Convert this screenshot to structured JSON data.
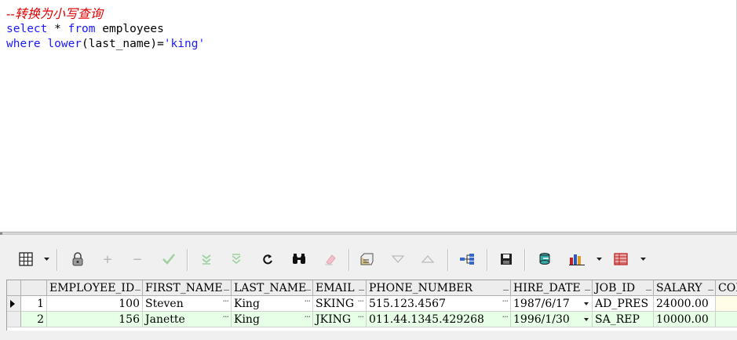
{
  "editor": {
    "comment": "--转换为小写查询",
    "line2": {
      "kw1": "select",
      "rest1": " * ",
      "kw2": "from",
      "rest2": " employees"
    },
    "line3": {
      "kw1": "where",
      "sp": " ",
      "kw2": "lower",
      "rest": "(last_name)=",
      "str": "'king'"
    }
  },
  "toolbar_icons": [
    "grid-icon",
    "lock-icon",
    "add-record-icon",
    "delete-record-icon",
    "post-changes-icon",
    "clear-filter-icon",
    "query-filter-icon",
    "refresh-icon",
    "find-icon",
    "clear-icon",
    "export-icon",
    "next-icon",
    "previous-icon",
    "tree-icon",
    "save-icon",
    "query-icon",
    "chart-icon",
    "table-view-icon"
  ],
  "grid": {
    "columns": [
      "EMPLOYEE_ID",
      "FIRST_NAME",
      "LAST_NAME",
      "EMAIL",
      "PHONE_NUMBER",
      "HIRE_DATE",
      "JOB_ID",
      "SALARY",
      "COM"
    ],
    "rows": [
      {
        "num": "1",
        "employee_id": "100",
        "first_name": "Steven",
        "last_name": "King",
        "email": "SKING",
        "phone_number": "515.123.4567",
        "hire_date": "1987/6/17",
        "job_id": "AD_PRES",
        "salary": "24000.00"
      },
      {
        "num": "2",
        "employee_id": "156",
        "first_name": "Janette",
        "last_name": "King",
        "email": "JKING",
        "phone_number": "011.44.1345.429268",
        "hire_date": "1996/1/30",
        "job_id": "SA_REP",
        "salary": "10000.00"
      }
    ]
  },
  "colors": {
    "keyword": "#1a1aff",
    "comment": "#e00000",
    "selected_row": "#e6ffe6"
  }
}
